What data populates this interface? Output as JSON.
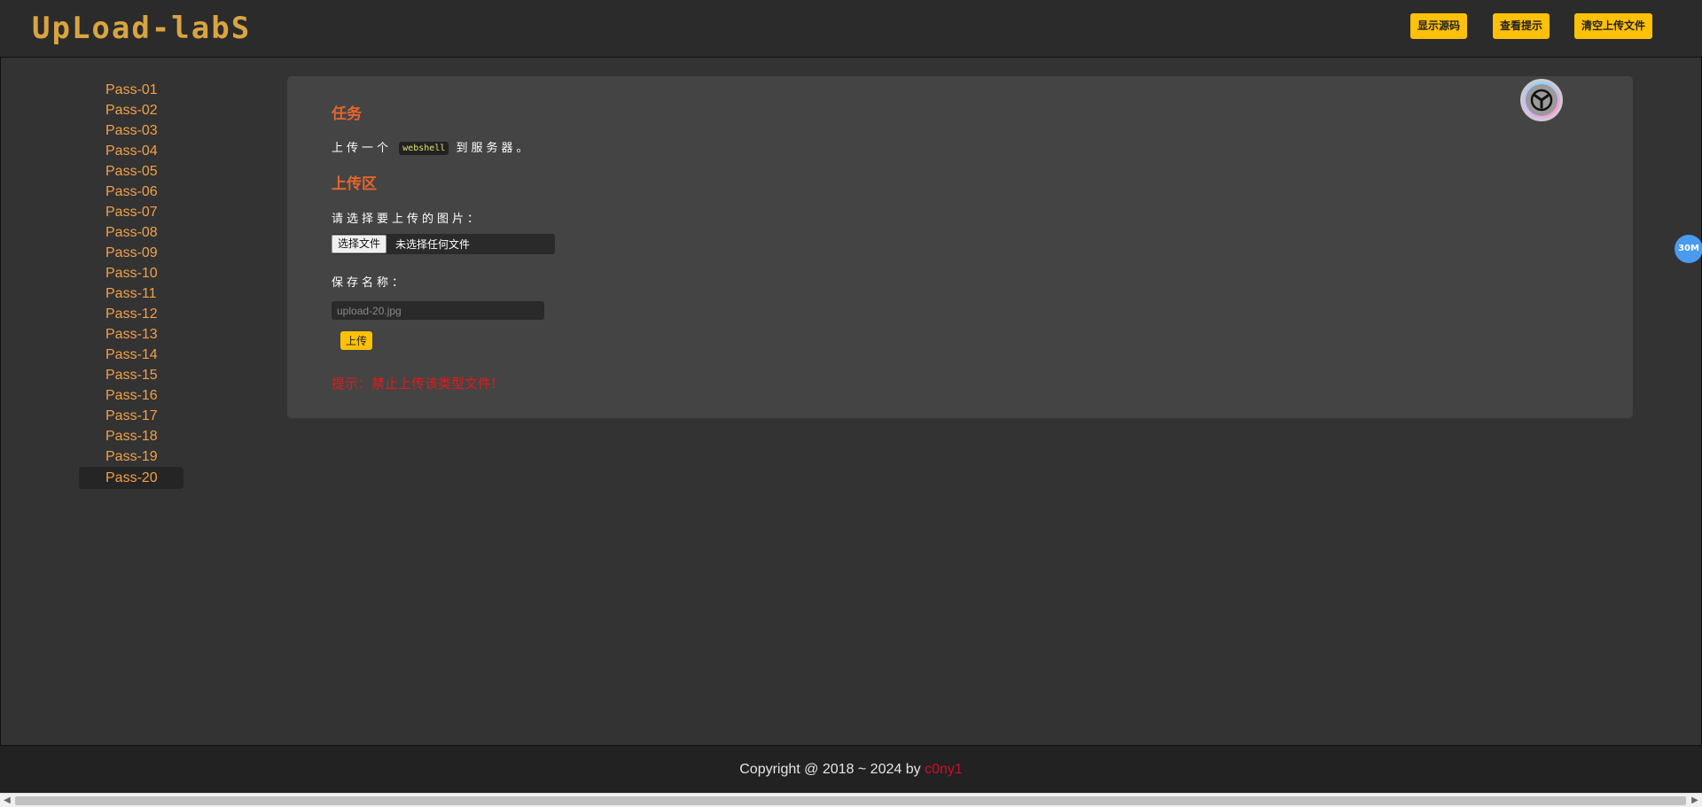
{
  "header": {
    "logo_text": "UpLoad-labS",
    "buttons": [
      "显示源码",
      "查看提示",
      "清空上传文件"
    ]
  },
  "sidebar": {
    "items": [
      "Pass-01",
      "Pass-02",
      "Pass-03",
      "Pass-04",
      "Pass-05",
      "Pass-06",
      "Pass-07",
      "Pass-08",
      "Pass-09",
      "Pass-10",
      "Pass-11",
      "Pass-12",
      "Pass-13",
      "Pass-14",
      "Pass-15",
      "Pass-16",
      "Pass-17",
      "Pass-18",
      "Pass-19",
      "Pass-20"
    ],
    "active": "Pass-20"
  },
  "task": {
    "title": "任务",
    "text_before": "上传一个",
    "code": "webshell",
    "text_after": "到服务器。"
  },
  "upload": {
    "title": "上传区",
    "choose_label": "请选择要上传的图片：",
    "file_button": "选择文件",
    "file_status": "未选择任何文件",
    "save_label": "保存名称：",
    "save_placeholder": "upload-20.jpg",
    "submit_label": "上传",
    "message": "提示：禁止上传该类型文件!"
  },
  "badge": "30M",
  "footer": {
    "copyright": "Copyright @ 2018 ~ 2024 by ",
    "author": "c0ny1"
  },
  "colors": {
    "accent": "#ffc107",
    "sidebar_link": "#f0a04b",
    "section_title": "#e8642a",
    "error": "#e01b1b"
  }
}
